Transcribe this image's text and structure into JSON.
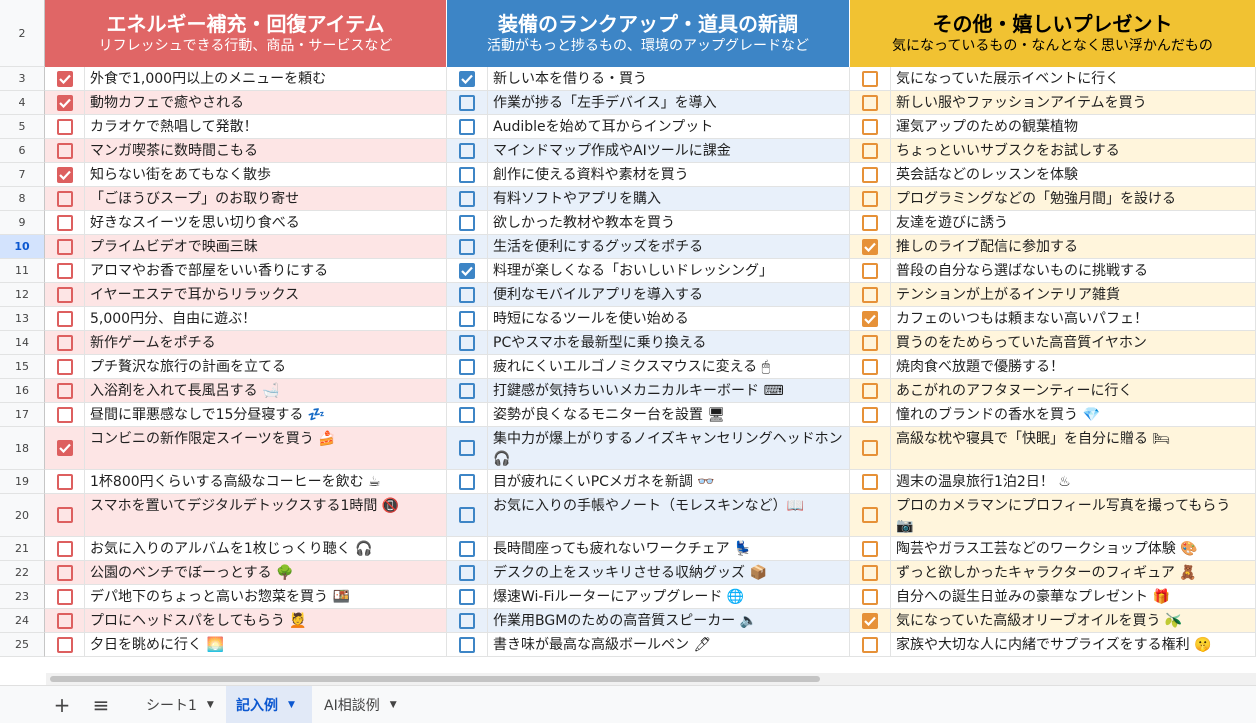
{
  "colors": {
    "col1_accent": "#e06666",
    "col2_accent": "#3d85c6",
    "col3_accent": "#f1c232",
    "check1": "#dd5f5f",
    "check2": "#3d85c6",
    "check3": "#e69138"
  },
  "header_row_number": "2",
  "selected_row": "10",
  "columns": [
    {
      "title": "エネルギー補充・回復アイテム",
      "subtitle": "リフレッシュできる行動、商品・サービスなど"
    },
    {
      "title": "装備のランクアップ・道具の新調",
      "subtitle": "活動がもっと捗るもの、環境のアップグレードなど"
    },
    {
      "title": "その他・嬉しいプレゼント",
      "subtitle": "気になっているもの・なんとなく思い浮かんだもの"
    }
  ],
  "rows": [
    {
      "num": "3",
      "c1": true,
      "t1": "外食で1,000円以上のメニューを頼む",
      "c2": true,
      "t2": "新しい本を借りる・買う",
      "c3": false,
      "t3": "気になっていた展示イベントに行く"
    },
    {
      "num": "4",
      "c1": true,
      "t1": "動物カフェで癒やされる",
      "c2": false,
      "t2": "作業が捗る「左手デバイス」を導入",
      "c3": false,
      "t3": "新しい服やファッションアイテムを買う"
    },
    {
      "num": "5",
      "c1": false,
      "t1": "カラオケで熱唱して発散！",
      "c2": false,
      "t2": "Audibleを始めて耳からインプット",
      "c3": false,
      "t3": "運気アップのための観葉植物"
    },
    {
      "num": "6",
      "c1": false,
      "t1": "マンガ喫茶に数時間こもる",
      "c2": false,
      "t2": "マインドマップ作成やAIツールに課金",
      "c3": false,
      "t3": "ちょっといいサブスクをお試しする"
    },
    {
      "num": "7",
      "c1": true,
      "t1": "知らない街をあてもなく散歩",
      "c2": false,
      "t2": "創作に使える資料や素材を買う",
      "c3": false,
      "t3": "英会話などのレッスンを体験"
    },
    {
      "num": "8",
      "c1": false,
      "t1": "「ごほうびスープ」のお取り寄せ",
      "c2": false,
      "t2": "有料ソフトやアプリを購入",
      "c3": false,
      "t3": "プログラミングなどの「勉強月間」を設ける"
    },
    {
      "num": "9",
      "c1": false,
      "t1": "好きなスイーツを思い切り食べる",
      "c2": false,
      "t2": "欲しかった教材や教本を買う",
      "c3": false,
      "t3": "友達を遊びに誘う"
    },
    {
      "num": "10",
      "c1": false,
      "t1": "プライムビデオで映画三昧",
      "c2": false,
      "t2": "生活を便利にするグッズをポチる",
      "c3": true,
      "t3": "推しのライブ配信に参加する"
    },
    {
      "num": "11",
      "c1": false,
      "t1": "アロマやお香で部屋をいい香りにする",
      "c2": true,
      "t2": "料理が楽しくなる「おいしいドレッシング」",
      "c3": false,
      "t3": "普段の自分なら選ばないものに挑戦する"
    },
    {
      "num": "12",
      "c1": false,
      "t1": "イヤーエステで耳からリラックス",
      "c2": false,
      "t2": "便利なモバイルアプリを導入する",
      "c3": false,
      "t3": "テンションが上がるインテリア雑貨"
    },
    {
      "num": "13",
      "c1": false,
      "t1": "5,000円分、自由に遊ぶ！",
      "c2": false,
      "t2": "時短になるツールを使い始める",
      "c3": true,
      "t3": "カフェのいつもは頼まない高いパフェ！"
    },
    {
      "num": "14",
      "c1": false,
      "t1": "新作ゲームをポチる",
      "c2": false,
      "t2": "PCやスマホを最新型に乗り換える",
      "c3": false,
      "t3": "買うのをためらっていた高音質イヤホン"
    },
    {
      "num": "15",
      "c1": false,
      "t1": "プチ贅沢な旅行の計画を立てる",
      "c2": false,
      "t2": "疲れにくいエルゴノミクスマウスに変える 🖱",
      "c3": false,
      "t3": "焼肉食べ放題で優勝する！"
    },
    {
      "num": "16",
      "c1": false,
      "t1": "入浴剤を入れて長風呂する 🛁",
      "c2": false,
      "t2": "打鍵感が気持ちいいメカニカルキーボード ⌨",
      "c3": false,
      "t3": "あこがれのアフタヌーンティーに行く"
    },
    {
      "num": "17",
      "c1": false,
      "t1": "昼間に罪悪感なしで15分昼寝する 💤",
      "c2": false,
      "t2": "姿勢が良くなるモニター台を設置 🖥",
      "c3": false,
      "t3": "憧れのブランドの香水を買う 💎"
    },
    {
      "num": "18",
      "c1": true,
      "t1": "コンビニの新作限定スイーツを買う 🍰",
      "c2": false,
      "t2": "集中力が爆上がりするノイズキャンセリングヘッドホン 🎧",
      "c3": false,
      "t3": "高級な枕や寝具で「快眠」を自分に贈る 🛏"
    },
    {
      "num": "19",
      "c1": false,
      "t1": "1杯800円くらいする高級なコーヒーを飲む ☕",
      "c2": false,
      "t2": "目が疲れにくいPCメガネを新調 👓",
      "c3": false,
      "t3": "週末の温泉旅行1泊2日！ ♨"
    },
    {
      "num": "20",
      "c1": false,
      "t1": "スマホを置いてデジタルデトックスする1時間 📵",
      "c2": false,
      "t2": "お気に入りの手帳やノート（モレスキンなど）📖",
      "c3": false,
      "t3": "プロのカメラマンにプロフィール写真を撮ってもらう 📷"
    },
    {
      "num": "21",
      "c1": false,
      "t1": "お気に入りのアルバムを1枚じっくり聴く 🎧",
      "c2": false,
      "t2": "長時間座っても疲れないワークチェア 💺",
      "c3": false,
      "t3": "陶芸やガラス工芸などのワークショップ体験 🎨"
    },
    {
      "num": "22",
      "c1": false,
      "t1": "公園のベンチでぼーっとする 🌳",
      "c2": false,
      "t2": "デスクの上をスッキリさせる収納グッズ 📦",
      "c3": false,
      "t3": "ずっと欲しかったキャラクターのフィギュア 🧸"
    },
    {
      "num": "23",
      "c1": false,
      "t1": "デパ地下のちょっと高いお惣菜を買う 🍱",
      "c2": false,
      "t2": "爆速Wi-Fiルーターにアップグレード 🌐",
      "c3": false,
      "t3": "自分への誕生日並みの豪華なプレゼント 🎁"
    },
    {
      "num": "24",
      "c1": false,
      "t1": "プロにヘッドスパをしてもらう 💆",
      "c2": false,
      "t2": "作業用BGMのための高音質スピーカー 🔈",
      "c3": true,
      "t3": "気になっていた高級オリーブオイルを買う 🫒"
    },
    {
      "num": "25",
      "c1": false,
      "t1": "夕日を眺めに行く 🌅",
      "c2": false,
      "t2": "書き味が最高な高級ボールペン 🖊",
      "c3": false,
      "t3": "家族や大切な人に内緒でサプライズをする権利 🤫"
    }
  ],
  "tabbar": {
    "add_icon": "+",
    "menu_icon": "≡",
    "tabs": [
      {
        "label": "シート1",
        "arrow": "▼",
        "active": false
      },
      {
        "label": "記入例",
        "arrow": "▼",
        "active": true
      },
      {
        "label": "AI相談例",
        "arrow": "▼",
        "active": false
      }
    ]
  }
}
